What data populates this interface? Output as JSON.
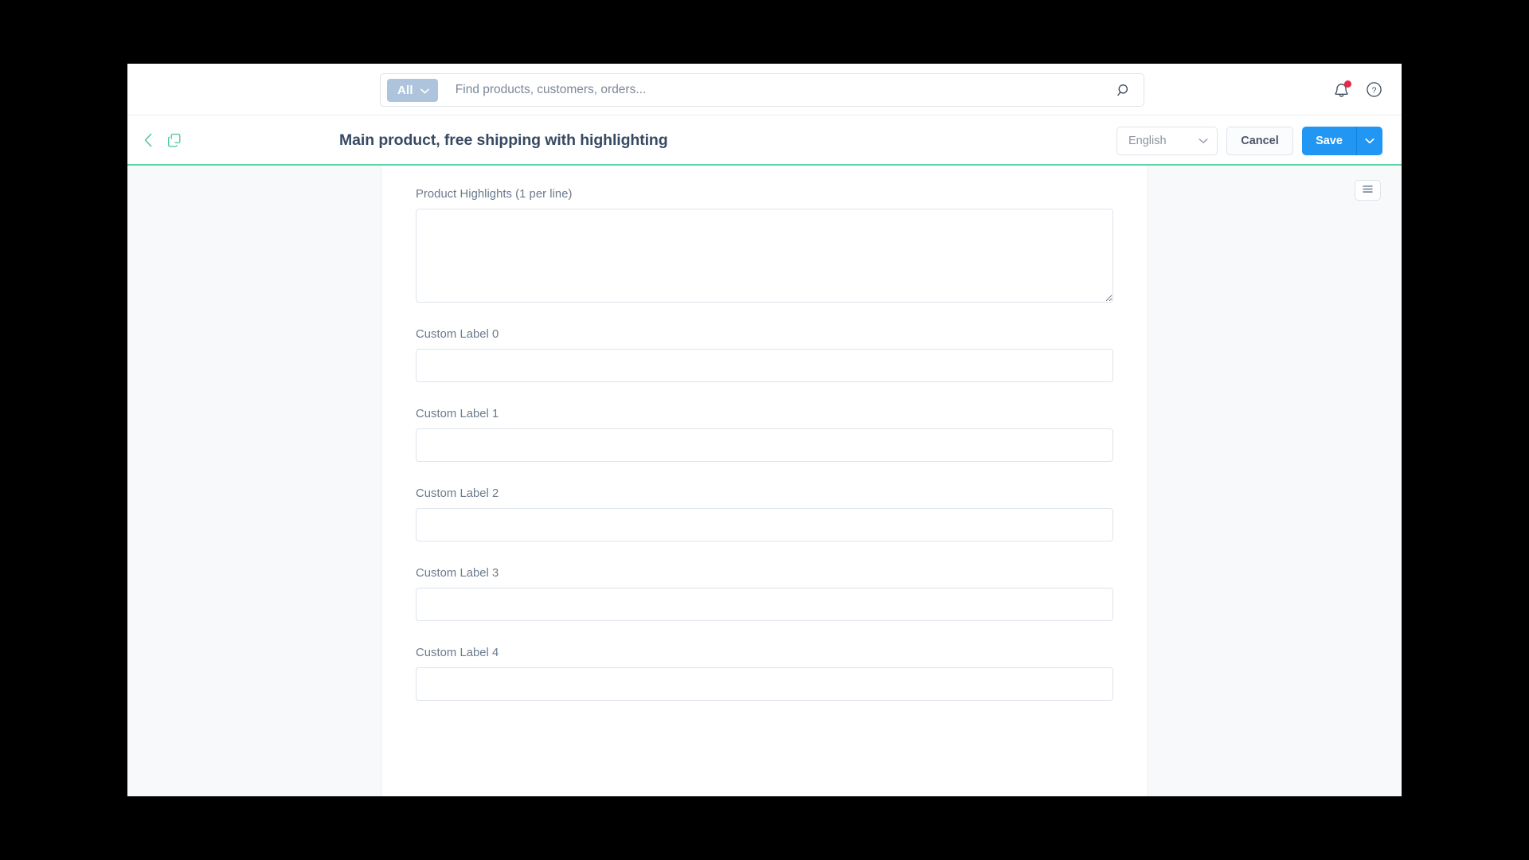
{
  "topbar": {
    "scope_filter": {
      "label": "All",
      "icon": "chevron-down-icon"
    },
    "search": {
      "placeholder": "Find products, customers, orders...",
      "value": "",
      "submit_icon": "search-icon"
    },
    "notifications_icon": "bell-icon",
    "notifications_has_alert": true,
    "help_icon": "question-circle-icon"
  },
  "toolbar": {
    "back_icon": "chevron-left-icon",
    "duplicate_icon": "copy-icon",
    "title": "Main product, free shipping with highlighting",
    "language": {
      "value": "English",
      "icon": "chevron-down-icon"
    },
    "cancel_label": "Cancel",
    "save_label": "Save",
    "save_more_icon": "chevron-down-icon",
    "accent_color": "#5fd7a8"
  },
  "content": {
    "list_menu_icon": "list-menu-icon",
    "fields": [
      {
        "label": "Product Highlights (1 per line)",
        "type": "textarea",
        "value": ""
      },
      {
        "label": "Custom Label 0",
        "type": "text",
        "value": ""
      },
      {
        "label": "Custom Label 1",
        "type": "text",
        "value": ""
      },
      {
        "label": "Custom Label 2",
        "type": "text",
        "value": ""
      },
      {
        "label": "Custom Label 3",
        "type": "text",
        "value": ""
      },
      {
        "label": "Custom Label 4",
        "type": "text",
        "value": ""
      }
    ]
  },
  "colors": {
    "primary_blue": "#2196f3",
    "accent_green": "#5fd7a8",
    "filter_pill": "#aec4dc",
    "alert_red": "#e8264a"
  }
}
